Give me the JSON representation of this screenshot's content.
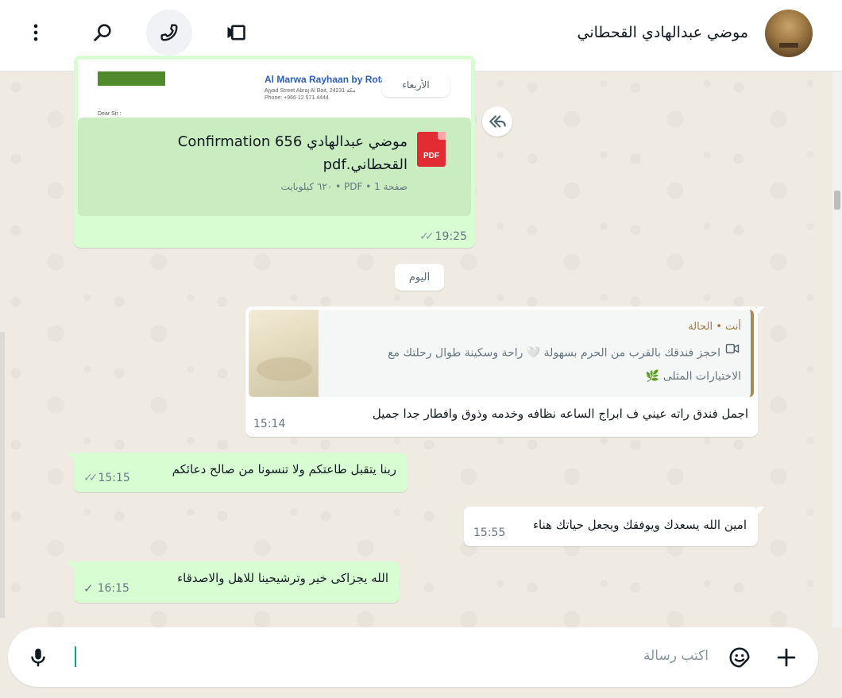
{
  "header": {
    "contact_name": "موضي عبدالهادي القحطاني",
    "icons": [
      "menu-dots-icon",
      "search-icon",
      "phone-icon",
      "video-icon"
    ]
  },
  "document_message": {
    "preview": {
      "hotel_name": "Al Marwa Rayhaan by Rotana",
      "address": "Ajyad Street Abraj Al Bait, 24231 مكة",
      "phone": "Phone: +966 12 571 4444",
      "salutation": "Dear Sir :",
      "weekday_chip": "الأربعاء"
    },
    "file_icon_label": "PDF",
    "file_name": "موضي عبدالهادي Confirmation 656 القحطاني.pdf",
    "file_meta": "صفحة 1 • PDF • ٦٢٠ كيلوبايت",
    "time": "19:25",
    "status": "read"
  },
  "day_separator": "اليوم",
  "status_reply": {
    "quote_sender": "أنت • الحالة",
    "quote_text": "احجز فندقك بالقرب من الحرم بسهولة 🤍 راحة وسكينة طوال رحلتك مع الاختيارات المثلى 🌿",
    "text": "اجمل فندق راته عيني ف ابراج الساعه نظافه وخدمه وذوق وافطار جدا جميل",
    "time": "15:14"
  },
  "messages": [
    {
      "direction": "out",
      "text": "ربنا يتقبل طاعتكم ولا تنسونا من صالح دعائكم",
      "time": "15:15",
      "status": "read"
    },
    {
      "direction": "in",
      "text": "امين الله يسعدك ويوفقك ويجعل حياتك هناء",
      "time": "15:55"
    },
    {
      "direction": "out",
      "text": "الله يجزاکی خیر وترشيحينا للاهل والاصدقاء",
      "time": "16:15",
      "status": "sent"
    }
  ],
  "composer": {
    "placeholder": "اكتب رسالة",
    "icons": [
      "mic-icon",
      "sticker-icon",
      "attach-plus-icon"
    ]
  },
  "colors": {
    "outgoing_bubble": "#d9fdd3",
    "incoming_bubble": "#ffffff",
    "read_ticks": "#53bdeb",
    "accent": "#00a884",
    "pdf_red": "#e22b32"
  }
}
